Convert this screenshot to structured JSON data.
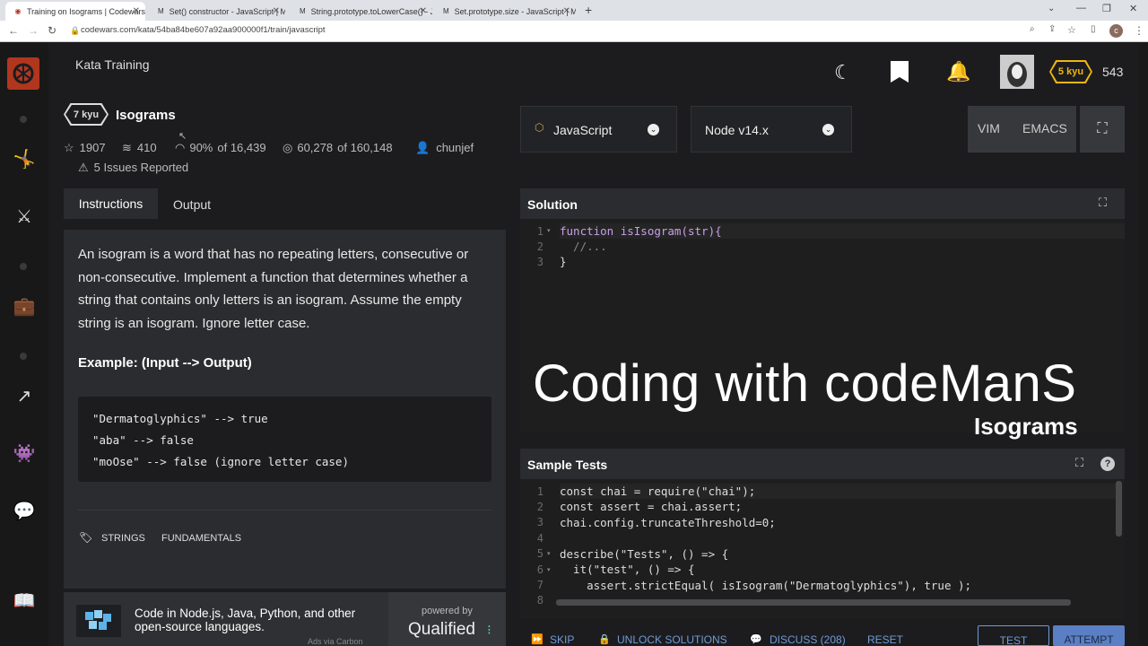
{
  "browser": {
    "tabs": [
      {
        "title": "Training on Isograms | Codewars",
        "active": true
      },
      {
        "title": "Set() constructor - JavaScript | MDN",
        "active": false
      },
      {
        "title": "String.prototype.toLowerCase() - JavaScript",
        "active": false
      },
      {
        "title": "Set.prototype.size - JavaScript | MDN",
        "active": false
      }
    ],
    "url": "codewars.com/kata/54ba84be607a92aa900000f1/train/javascript"
  },
  "header": {
    "page_label": "Kata Training",
    "user_rank": "5 kyu",
    "honor": "543"
  },
  "kata": {
    "rank": "7 kyu",
    "title": "Isograms",
    "stars": "1907",
    "collections": "410",
    "satisfaction": "90%",
    "satisfaction_of": "of 16,439",
    "completed": "60,278",
    "completed_of": "of 160,148",
    "author": "chunjef",
    "issues": "5 Issues Reported"
  },
  "tabs": {
    "instructions": "Instructions",
    "output": "Output"
  },
  "description": {
    "paragraph": "An isogram is a word that has no repeating letters, consecutive or non-consecutive. Implement a function that determines whether a string that contains only letters is an isogram. Assume the empty string is an isogram. Ignore letter case.",
    "example_heading": "Example: (Input --> Output)",
    "example_lines": [
      "\"Dermatoglyphics\" --> true",
      "\"aba\" --> false",
      "\"moOse\" --> false (ignore letter case)"
    ],
    "tags": [
      "STRINGS",
      "FUNDAMENTALS"
    ]
  },
  "ad": {
    "text": "Code in Node.js, Java, Python, and other open-source languages.",
    "powered_by": "powered by",
    "brand": "Qualified",
    "via": "Ads via Carbon"
  },
  "editor": {
    "language": "JavaScript",
    "runtime": "Node v14.x",
    "modes": [
      "VIM",
      "EMACS"
    ],
    "solution_title": "Solution",
    "solution_lines": [
      "function isIsogram(str){",
      "  //...",
      "}"
    ],
    "overlay_title": "Coding with codeManS",
    "overlay_sub": "Isograms",
    "tests_title": "Sample Tests",
    "test_lines": [
      "const chai = require(\"chai\");",
      "const assert = chai.assert;",
      "chai.config.truncateThreshold=0;",
      "",
      "describe(\"Tests\", () => {",
      "  it(\"test\", () => {",
      "    assert.strictEqual( isIsogram(\"Dermatoglyphics\"), true );"
    ]
  },
  "actions": {
    "skip": "SKIP",
    "unlock": "UNLOCK SOLUTIONS",
    "discuss": "DISCUSS (208)",
    "reset": "RESET",
    "test": "TEST",
    "attempt": "ATTEMPT"
  },
  "colors": {
    "brand_red": "#b1361e",
    "kyu_yellow": "#ecb613",
    "link_blue": "#6f9bd6"
  }
}
